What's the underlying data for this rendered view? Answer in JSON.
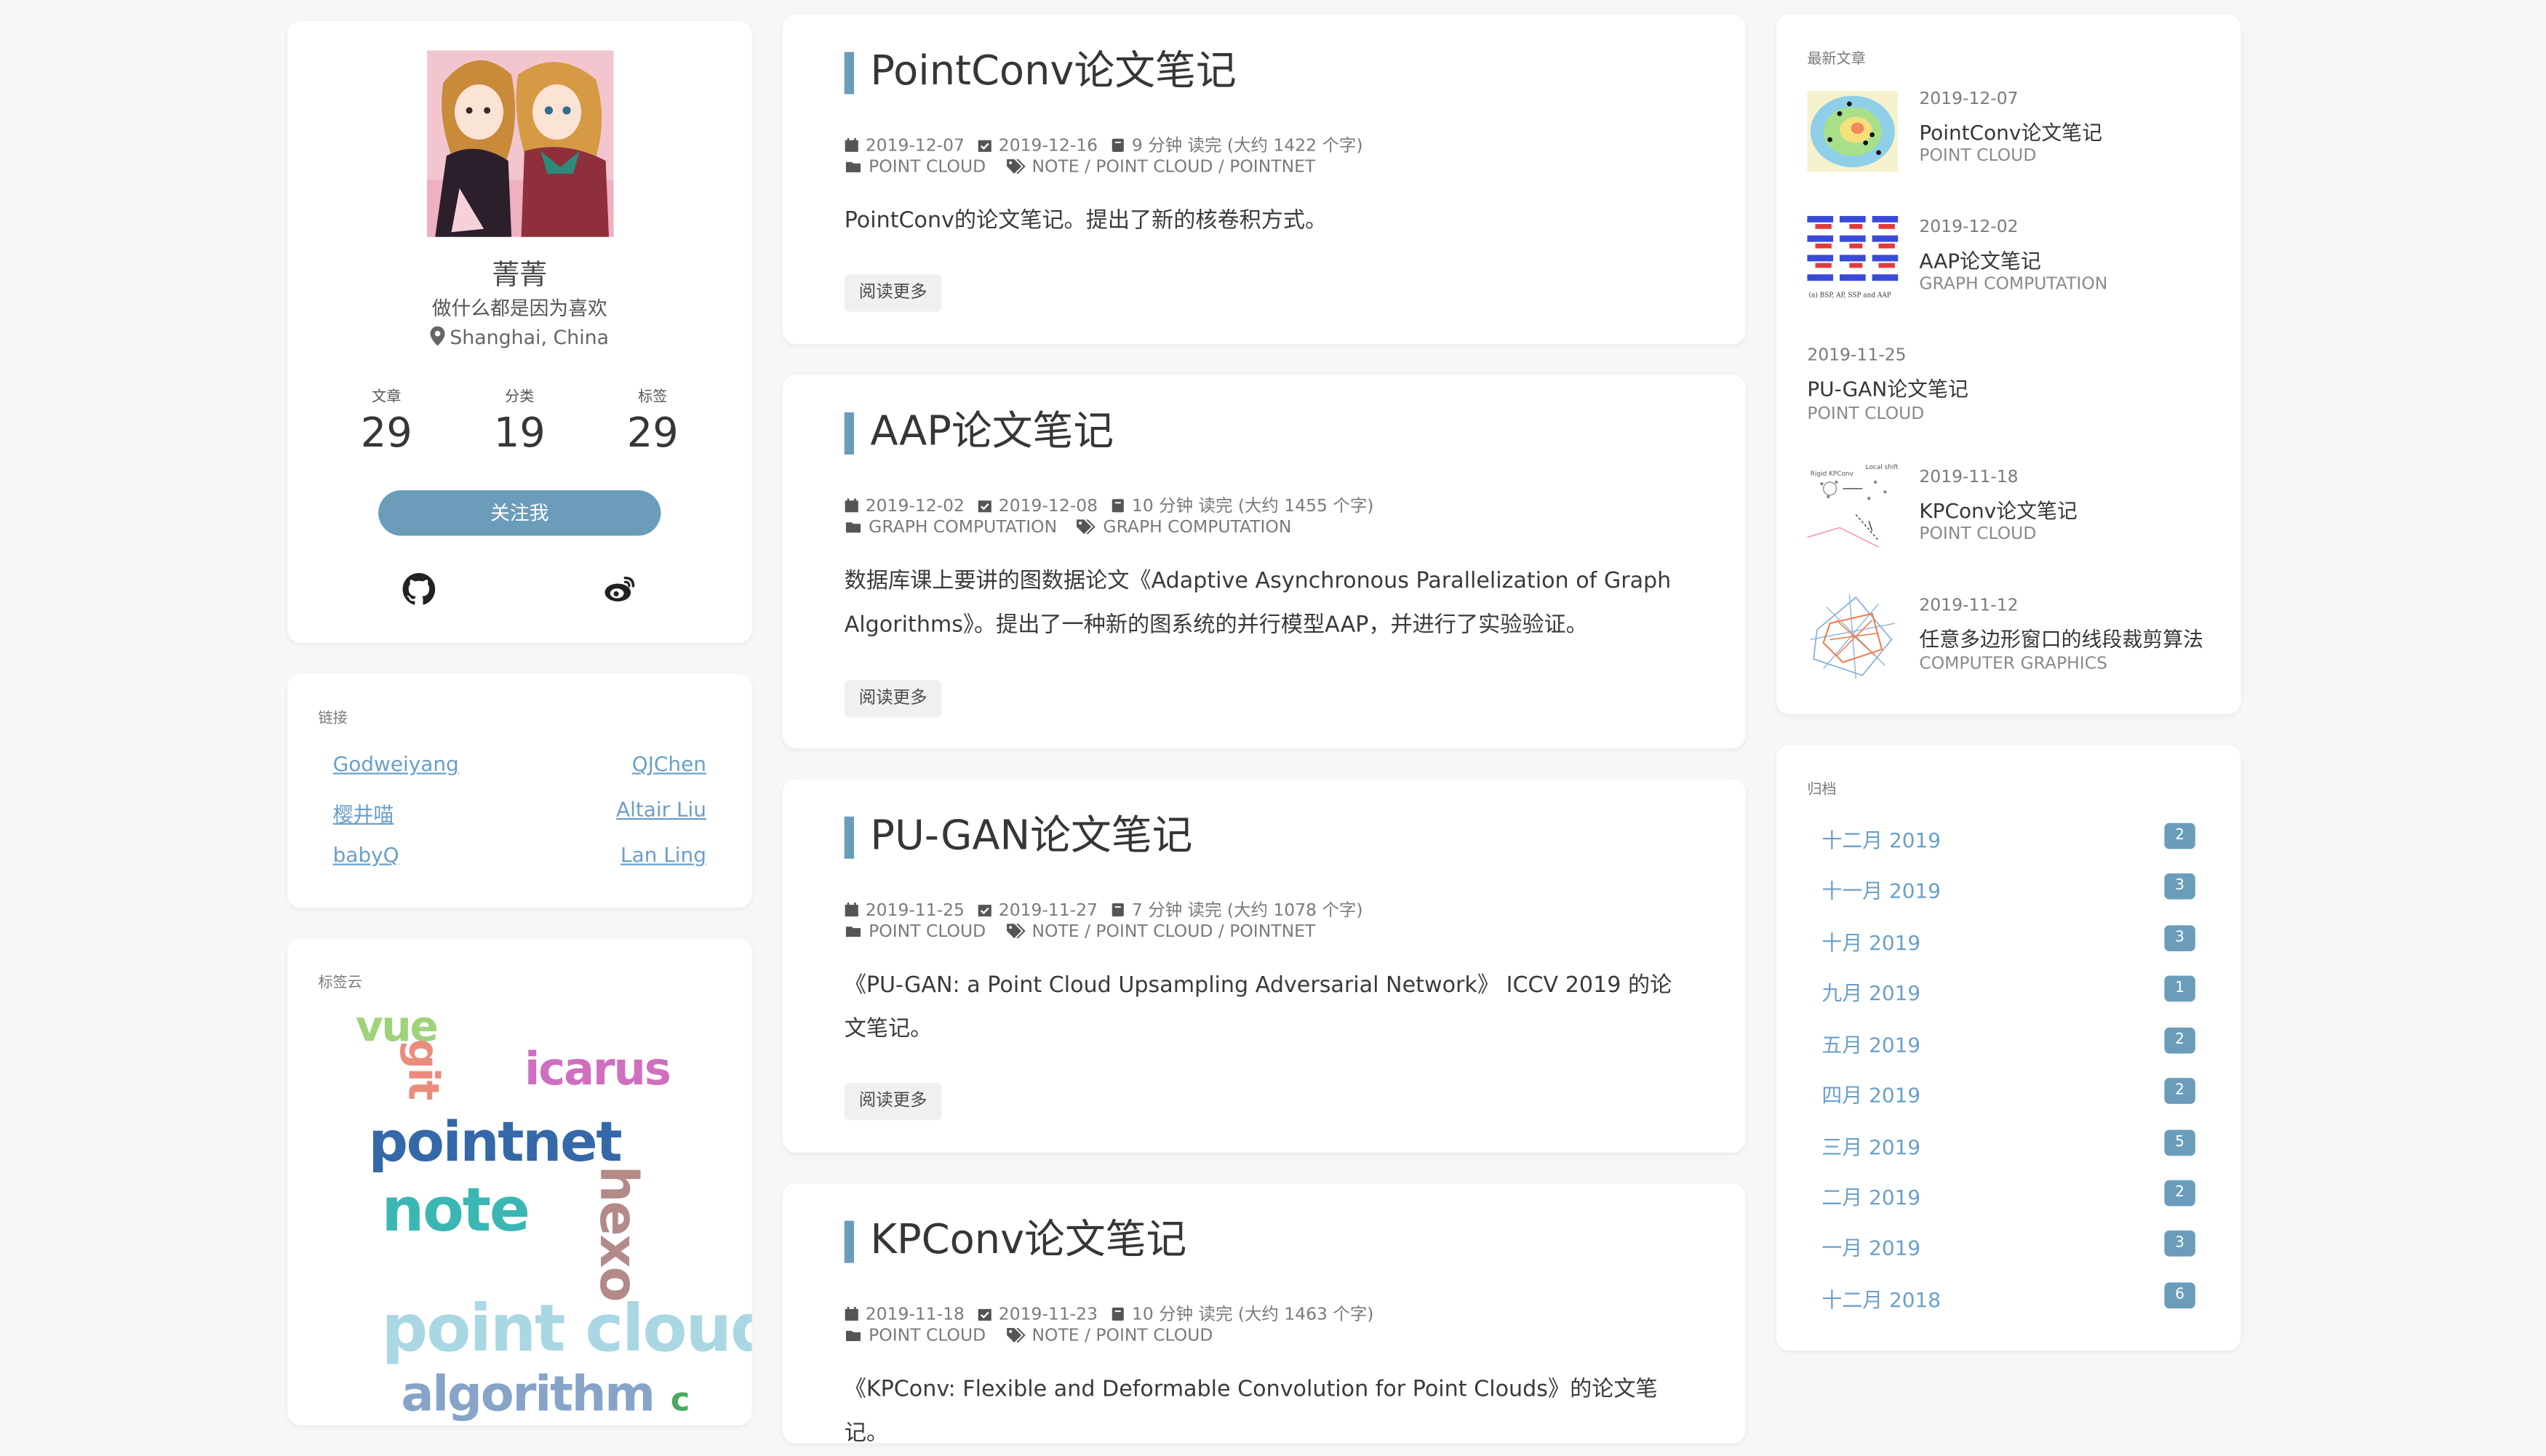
{
  "profile": {
    "name": "菁菁",
    "motto": "做什么都是因为喜欢",
    "location": "Shanghai, China",
    "stats": [
      {
        "label": "文章",
        "value": "29"
      },
      {
        "label": "分类",
        "value": "19"
      },
      {
        "label": "标签",
        "value": "29"
      }
    ],
    "follow_label": "关注我",
    "social": [
      "github-icon",
      "weibo-icon"
    ]
  },
  "links": {
    "title": "链接",
    "items": [
      "Godweiyang",
      "QJChen",
      "樱井喵",
      "Altair Liu",
      "babyQ",
      "Lan Ling"
    ]
  },
  "tagcloud": {
    "title": "标签云",
    "tags": [
      "vue",
      "git",
      "icarus",
      "pointnet",
      "note",
      "hexo",
      "point cloud",
      "algorithm",
      "c"
    ]
  },
  "posts": [
    {
      "title": "PointConv论文笔记",
      "created": "2019-12-07",
      "updated": "2019-12-16",
      "reading": "9 分钟 读完 (大约 1422 个字)",
      "category": "POINT CLOUD",
      "tags": "NOTE / POINT CLOUD / POINTNET",
      "excerpt": "PointConv的论文笔记。提出了新的核卷积方式。",
      "read_more": "阅读更多"
    },
    {
      "title": "AAP论文笔记",
      "created": "2019-12-02",
      "updated": "2019-12-08",
      "reading": "10 分钟 读完 (大约 1455 个字)",
      "category": "GRAPH COMPUTATION",
      "tags": "GRAPH COMPUTATION",
      "excerpt": "数据库课上要讲的图数据论文《Adaptive Asynchronous Parallelization of Graph Algorithms》。提出了一种新的图系统的并行模型AAP，并进行了实验验证。",
      "read_more": "阅读更多"
    },
    {
      "title": "PU-GAN论文笔记",
      "created": "2019-11-25",
      "updated": "2019-11-27",
      "reading": "7 分钟 读完 (大约 1078 个字)",
      "category": "POINT CLOUD",
      "tags": "NOTE / POINT CLOUD / POINTNET",
      "excerpt": "《PU-GAN: a Point Cloud Upsampling Adversarial Network》 ICCV 2019 的论文笔记。",
      "read_more": "阅读更多"
    },
    {
      "title": "KPConv论文笔记",
      "created": "2019-11-18",
      "updated": "2019-11-23",
      "reading": "10 分钟 读完 (大约 1463 个字)",
      "category": "POINT CLOUD",
      "tags": "NOTE / POINT CLOUD",
      "excerpt": "《KPConv: Flexible and Deformable Convolution for Point Clouds》的论文笔记。"
    }
  ],
  "recent": {
    "title": "最新文章",
    "items": [
      {
        "date": "2019-12-07",
        "title": "PointConv论文笔记",
        "category": "POINT CLOUD"
      },
      {
        "date": "2019-12-02",
        "title": "AAP论文笔记",
        "category": "GRAPH COMPUTATION"
      },
      {
        "date": "2019-11-25",
        "title": "PU-GAN论文笔记",
        "category": "POINT CLOUD"
      },
      {
        "date": "2019-11-18",
        "title": "KPConv论文笔记",
        "category": "POINT CLOUD"
      },
      {
        "date": "2019-11-12",
        "title": "任意多边形窗口的线段裁剪算法",
        "category": "COMPUTER GRAPHICS"
      }
    ],
    "aap_thumb_caption": "(a) BSP, AP, SSP and AAP"
  },
  "archives": {
    "title": "归档",
    "items": [
      {
        "month": "十二月 2019",
        "count": "2"
      },
      {
        "month": "十一月 2019",
        "count": "3"
      },
      {
        "month": "十月 2019",
        "count": "3"
      },
      {
        "month": "九月 2019",
        "count": "1"
      },
      {
        "month": "五月 2019",
        "count": "2"
      },
      {
        "month": "四月 2019",
        "count": "2"
      },
      {
        "month": "三月 2019",
        "count": "5"
      },
      {
        "month": "二月 2019",
        "count": "2"
      },
      {
        "month": "一月 2019",
        "count": "3"
      },
      {
        "month": "十二月 2018",
        "count": "6"
      }
    ]
  },
  "colors": {
    "accent": "#6b9dbb",
    "link": "#6a9fc9",
    "background": "#f7f7f7"
  }
}
